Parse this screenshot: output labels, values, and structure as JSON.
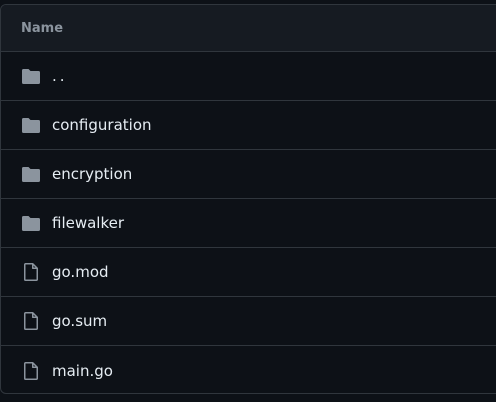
{
  "table": {
    "header": "Name",
    "rows": [
      {
        "name": "..",
        "type": "folder",
        "icon": "folder-icon"
      },
      {
        "name": "configuration",
        "type": "folder",
        "icon": "folder-icon"
      },
      {
        "name": "encryption",
        "type": "folder",
        "icon": "folder-icon"
      },
      {
        "name": "filewalker",
        "type": "folder",
        "icon": "folder-icon"
      },
      {
        "name": "go.mod",
        "type": "file",
        "icon": "file-icon"
      },
      {
        "name": "go.sum",
        "type": "file",
        "icon": "file-icon"
      },
      {
        "name": "main.go",
        "type": "file",
        "icon": "file-icon"
      }
    ]
  },
  "colors": {
    "background": "#0d1117",
    "header_background": "#161b22",
    "border": "#30363d",
    "icon": "#8b949e",
    "text": "#e6edf3"
  }
}
